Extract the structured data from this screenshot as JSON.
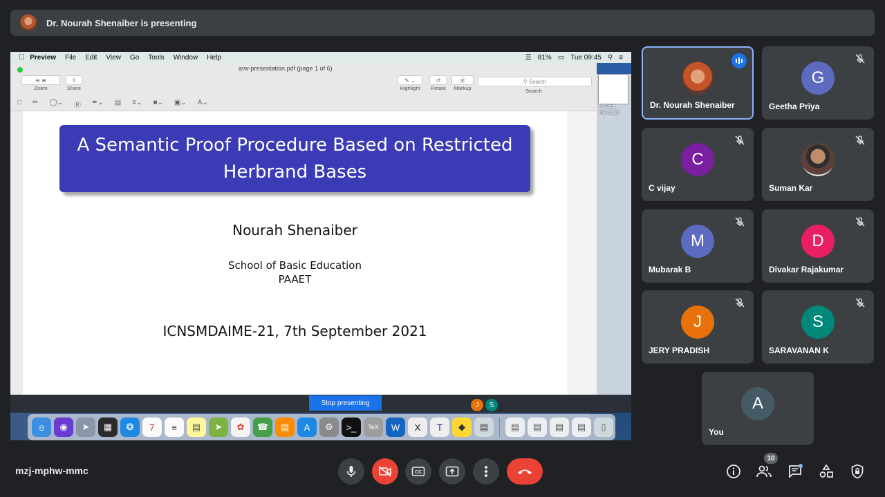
{
  "banner": {
    "presenter_text": "Dr. Nourah Shenaiber is presenting"
  },
  "mac_menubar": {
    "apple": "",
    "items": [
      "Preview",
      "File",
      "Edit",
      "View",
      "Go",
      "Tools",
      "Window",
      "Help"
    ],
    "battery": "81%",
    "clock": "Tue 09:45"
  },
  "preview": {
    "doc_title": "arw-presentation.pdf (page 1 of 6)",
    "tools": {
      "zoom": "Zoom",
      "share": "Share",
      "highlight": "Highlight",
      "rotate": "Rotate",
      "markup": "Markup"
    },
    "search_placeholder": "Search",
    "search_label": "Search"
  },
  "slide": {
    "title": "A Semantic Proof Procedure Based on Restricted Herbrand Bases",
    "author": "Nourah Shenaiber",
    "institution_line1": "School of Basic Education",
    "institution_line2": "PAAET",
    "conference": "ICNSMDAIME-21, 7th September 2021"
  },
  "side_window": {
    "caption_1": "n Shot",
    "caption_2": "09.41.22",
    "caption_3": "1.11"
  },
  "stop_presenting": "Stop presenting",
  "mini_avatars": [
    "J",
    "S"
  ],
  "participants": [
    {
      "name": "Dr. Nourah Shenaiber",
      "initial": "",
      "color": "#8a5a44",
      "photo": true,
      "speaking": true
    },
    {
      "name": "Geetha Priya",
      "initial": "G",
      "color": "#5c6bc0",
      "muted": true
    },
    {
      "name": "C vijay",
      "initial": "C",
      "color": "#7b1fa2",
      "muted": true
    },
    {
      "name": "Suman Kar",
      "initial": "",
      "color": "#6d4c41",
      "photo": true,
      "muted": true
    },
    {
      "name": "Mubarak B",
      "initial": "M",
      "color": "#5c6bc0",
      "muted": true
    },
    {
      "name": "Divakar Rajakumar",
      "initial": "D",
      "color": "#e91e63",
      "muted": true
    },
    {
      "name": "JERY PRADISH",
      "initial": "J",
      "color": "#e8710a",
      "muted": true
    },
    {
      "name": "SARAVANAN K",
      "initial": "S",
      "color": "#00897b",
      "muted": true
    },
    {
      "name": "You",
      "initial": "A",
      "color": "#455a64"
    }
  ],
  "meeting": {
    "code": "mzj-mphw-mmc",
    "participant_count": "10"
  },
  "colors": {
    "end_call": "#ea4335",
    "accent": "#1a73e8",
    "tile_bg": "#3c4043"
  }
}
